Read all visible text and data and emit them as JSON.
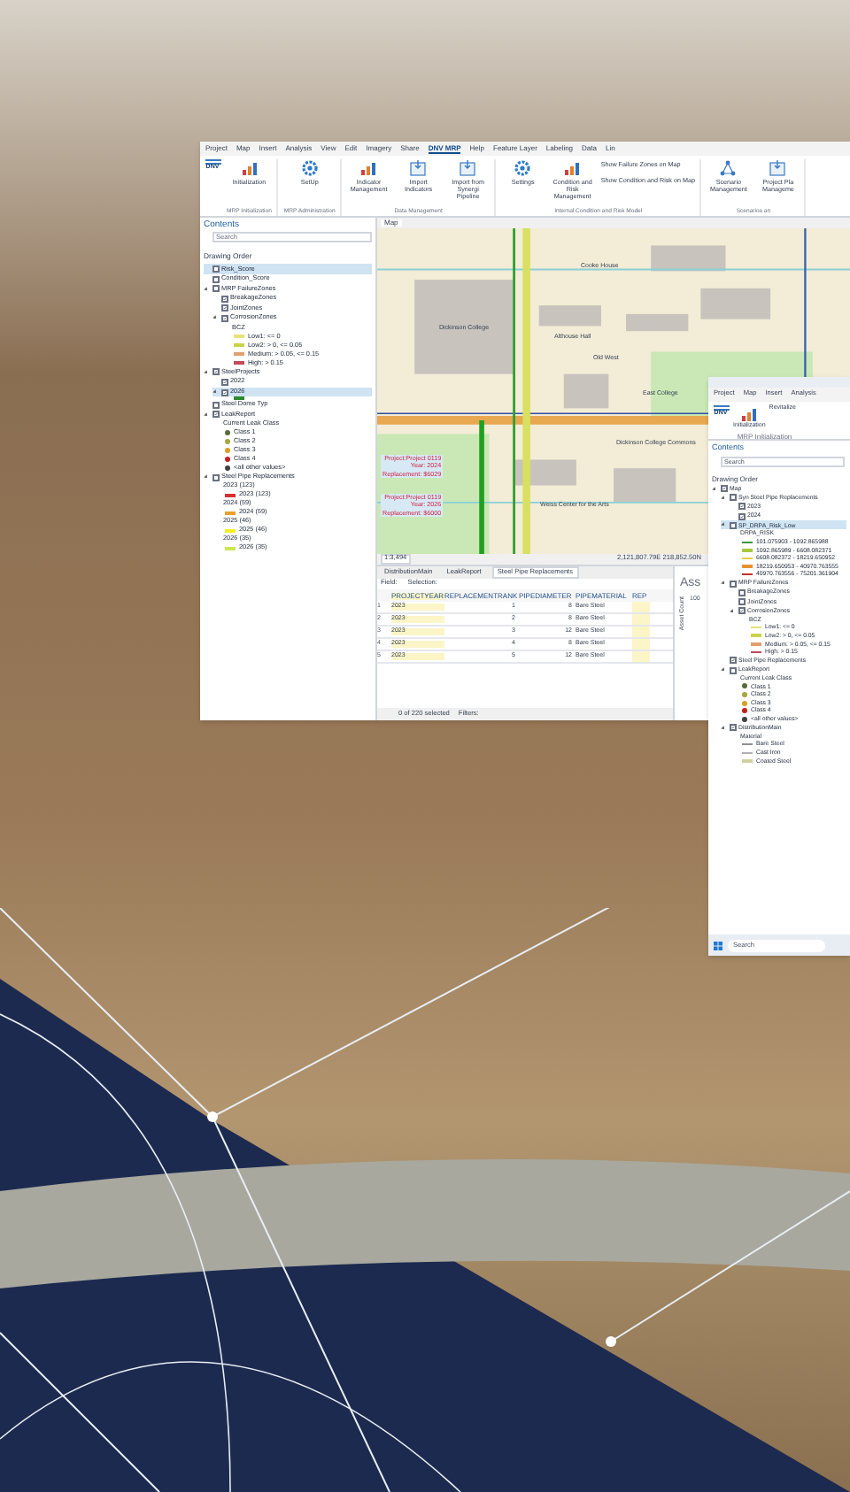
{
  "main_window": {
    "ribbon_tabs": [
      {
        "label": "Project",
        "selected": false
      },
      {
        "label": "Map",
        "selected": false
      },
      {
        "label": "Insert",
        "selected": false
      },
      {
        "label": "Analysis",
        "selected": false
      },
      {
        "label": "View",
        "selected": false
      },
      {
        "label": "Edit",
        "selected": false
      },
      {
        "label": "Imagery",
        "selected": false
      },
      {
        "label": "Share",
        "selected": false
      },
      {
        "label": "DNV MRP",
        "selected": true
      },
      {
        "label": "Help",
        "selected": false
      },
      {
        "label": "Feature Layer",
        "selected": false
      },
      {
        "label": "Labeling",
        "selected": false
      },
      {
        "label": "Data",
        "selected": false
      },
      {
        "label": "Lin",
        "selected": false
      }
    ],
    "logo": "DNV",
    "ribbon_groups": [
      {
        "label": "MRP Initialization",
        "buttons": [
          {
            "label": "Initialization",
            "kind": "chart"
          }
        ]
      },
      {
        "label": "MRP Administration",
        "buttons": [
          {
            "label": "SetUp",
            "kind": "gear"
          }
        ]
      },
      {
        "label": "Data Management",
        "buttons": [
          {
            "label": "Indicator Management",
            "kind": "chart"
          },
          {
            "label": "Import Indicators",
            "kind": "import"
          },
          {
            "label": "Import from Synergi Pipeline",
            "kind": "import"
          }
        ]
      },
      {
        "label": "Internal Condition and Risk Model",
        "buttons": [
          {
            "label": "Settings",
            "kind": "gear"
          },
          {
            "label": "Condition and Risk Management",
            "kind": "chart"
          }
        ],
        "links": [
          "Show Failure Zones on Map",
          "Show Condition and Risk on Map"
        ]
      },
      {
        "label": "Scenarios an",
        "buttons": [
          {
            "label": "Scenario Management",
            "kind": "network"
          },
          {
            "label": "Project Pla Manageme",
            "kind": "import"
          }
        ]
      }
    ],
    "contents": {
      "title": "Contents",
      "search": {
        "placeholder": "Search"
      },
      "heading": "Drawing Order",
      "tree": [
        {
          "label": "Risk_Score",
          "checked": false,
          "selected": true
        },
        {
          "label": "Condition_Score",
          "checked": false,
          "selected": false
        },
        {
          "label": "MRP FailureZones",
          "checked": false,
          "selected": false,
          "expanded": true,
          "children": [
            {
              "label": "BreakageZones",
              "checked": true,
              "selected": false
            },
            {
              "label": "JointZones",
              "checked": true,
              "selected": false
            },
            {
              "label": "CorrosionZones",
              "checked": true,
              "selected": false,
              "expanded": true,
              "legend": [
                {
                  "kind": "heading",
                  "label": "BCZ"
                },
                {
                  "kind": "line",
                  "label": "Low1: <= 0",
                  "color": "#e6e27a"
                },
                {
                  "kind": "line",
                  "label": "Low2: > 0, <= 0.05",
                  "color": "#c9d34a"
                },
                {
                  "kind": "line",
                  "label": "Medium: > 0.05, <= 0.15",
                  "color": "#e0a070"
                },
                {
                  "kind": "line",
                  "label": "High: > 0.15",
                  "color": "#c04a5a"
                }
              ]
            }
          ]
        },
        {
          "label": "SteelProjects",
          "checked": true,
          "selected": false,
          "expanded": true,
          "children": [
            {
              "label": "2022",
              "checked": true,
              "selected": false
            },
            {
              "label": "2026",
              "checked": true,
              "selected": true,
              "expanded": true,
              "legend": [
                {
                  "kind": "line",
                  "color": "#2f8a2f"
                }
              ]
            }
          ]
        },
        {
          "label": "Steel Dome Typ",
          "checked": false,
          "selected": false
        },
        {
          "label": "LeakReport",
          "checked": true,
          "selected": false,
          "expanded": true,
          "legend": [
            {
              "kind": "heading",
              "label": "Current Leak Class"
            },
            {
              "kind": "dot",
              "label": "Class 1",
              "color": "#5a6a3a"
            },
            {
              "kind": "dot",
              "label": "Class 2",
              "color": "#a8a440"
            },
            {
              "kind": "dot",
              "label": "Class 3",
              "color": "#d8a020"
            },
            {
              "kind": "dot",
              "label": "Class 4",
              "color": "#c02020"
            },
            {
              "kind": "dot",
              "label": "<all other values>",
              "color": "#404040"
            }
          ]
        },
        {
          "label": "Steel Pipe Replacements",
          "checked": false,
          "selected": false,
          "expanded": true,
          "legend": [
            {
              "kind": "heading",
              "label": "2023 (123)"
            },
            {
              "kind": "line",
              "label": "2023 (123)",
              "color": "#d83030"
            },
            {
              "kind": "heading",
              "label": "2024 (59)"
            },
            {
              "kind": "line",
              "label": "2024 (59)",
              "color": "#e8a030"
            },
            {
              "kind": "heading",
              "label": "2025 (46)"
            },
            {
              "kind": "line",
              "label": "2025 (46)",
              "color": "#f0f020"
            },
            {
              "kind": "heading",
              "label": "2026 (35)"
            },
            {
              "kind": "line",
              "label": "2026 (35)",
              "color": "#c8e850"
            }
          ]
        }
      ]
    },
    "map": {
      "tab": "Map",
      "labels": [
        "Cooke House",
        "Dickinson College",
        "Althouse Hall",
        "Old West",
        "East College",
        "Dickinson College Commons",
        "Weiss Center for the Arts"
      ],
      "popups": [
        [
          "Project:Project 0119",
          "Year: 2024",
          "Replacement: $6029"
        ],
        [
          "Project:Project 0119",
          "Year: 2026",
          "Replacement: $6000"
        ]
      ],
      "scale": "1:3,494",
      "coordinates": "2,121,807.79E 218,852.50N"
    },
    "table": {
      "tabs": [
        {
          "label": "DistributionMain",
          "selected": false
        },
        {
          "label": "LeakReport",
          "selected": false
        },
        {
          "label": "Steel Pipe Replacements",
          "selected": true
        }
      ],
      "field_label": "Field:",
      "selection_label": "Selection:",
      "columns": [
        "",
        "PROJECTYEAR",
        "REPLACEMENTRANK",
        "PIPEDIAMETER",
        "PIPEMATERIAL",
        "REP"
      ],
      "rows": [
        [
          "1",
          "2023",
          "1",
          "8",
          "Bare Steel"
        ],
        [
          "2",
          "2023",
          "2",
          "8",
          "Bare Steel"
        ],
        [
          "3",
          "2023",
          "3",
          "12",
          "Bare Steel"
        ],
        [
          "4",
          "2023",
          "4",
          "8",
          "Bare Steel"
        ],
        [
          "5",
          "2023",
          "5",
          "12",
          "Bare Steel"
        ]
      ],
      "status": "0 of 220 selected",
      "filters": "Filters:"
    },
    "chart_panel": {
      "title": "Ass",
      "tick": "100",
      "axis_label": "Asset Count"
    }
  },
  "second_window": {
    "ribbon_tabs": [
      {
        "label": "Project",
        "selected": false
      },
      {
        "label": "Map",
        "selected": false
      },
      {
        "label": "Insert",
        "selected": false
      },
      {
        "label": "Analysis",
        "selected": false
      }
    ],
    "logo": "DNV",
    "buttons": [
      "Initialization",
      "Revitalize"
    ],
    "group": "MRP Initialization",
    "contents": {
      "title": "Contents",
      "search": {
        "value": "Search"
      },
      "heading": "Drawing Order",
      "tree": [
        {
          "label": "Map",
          "checked": true,
          "selected": false,
          "expanded": true,
          "children": [
            {
              "label": "Syn Steel Pipe Replacements",
              "checked": false,
              "selected": false,
              "expanded": true,
              "children": [
                {
                  "label": "2023",
                  "checked": true,
                  "selected": false
                },
                {
                  "label": "2024",
                  "checked": true,
                  "selected": false
                }
              ]
            },
            {
              "label": "SP_DRPA_Risk_Low",
              "checked": false,
              "selected": true,
              "expanded": true,
              "legend": [
                {
                  "kind": "heading",
                  "label": "DRPA_RISK"
                },
                {
                  "kind": "line",
                  "label": "101.075903 - 1092.865988",
                  "color": "#3a9a3a"
                },
                {
                  "kind": "line",
                  "label": "1092.865989 - 6608.082371",
                  "color": "#a8c840"
                },
                {
                  "kind": "line",
                  "label": "6608.082372 - 18219.650952",
                  "color": "#e8d040"
                },
                {
                  "kind": "line",
                  "label": "18219.650953 - 40970.763555",
                  "color": "#e89030"
                },
                {
                  "kind": "line",
                  "label": "40970.763556 - 75201.361904",
                  "color": "#c83030"
                }
              ]
            },
            {
              "label": "MRP FailureZones",
              "checked": false,
              "selected": false,
              "expanded": true,
              "children": [
                {
                  "label": "BreakageZones",
                  "checked": false,
                  "selected": false
                },
                {
                  "label": "JointZones",
                  "checked": false,
                  "selected": false
                },
                {
                  "label": "CorrosionZones",
                  "checked": true,
                  "selected": false,
                  "expanded": true,
                  "legend": [
                    {
                      "kind": "heading",
                      "label": "BCZ"
                    },
                    {
                      "kind": "line",
                      "label": "Low1: <= 0",
                      "color": "#e6e27a"
                    },
                    {
                      "kind": "line",
                      "label": "Low2: > 0, <= 0.05",
                      "color": "#c9d34a"
                    },
                    {
                      "kind": "line",
                      "label": "Medium: > 0.05, <= 0.15",
                      "color": "#e0a070"
                    },
                    {
                      "kind": "line",
                      "label": "High: > 0.15",
                      "color": "#c04a5a"
                    }
                  ]
                }
              ]
            },
            {
              "label": "Steel Pipe Replacements",
              "checked": true,
              "selected": false
            },
            {
              "label": "LeakReport",
              "checked": false,
              "selected": false,
              "expanded": true,
              "legend": [
                {
                  "kind": "heading",
                  "label": "Current Leak Class"
                },
                {
                  "kind": "dot",
                  "label": "Class 1",
                  "color": "#5a6a3a"
                },
                {
                  "kind": "dot",
                  "label": "Class 2",
                  "color": "#a8a440"
                },
                {
                  "kind": "dot",
                  "label": "Class 3",
                  "color": "#d8a020"
                },
                {
                  "kind": "dot",
                  "label": "Class 4",
                  "color": "#c02020"
                },
                {
                  "kind": "dot",
                  "label": "<all other values>",
                  "color": "#404040"
                }
              ]
            },
            {
              "label": "DistributionMain",
              "checked": true,
              "selected": false,
              "expanded": true,
              "legend": [
                {
                  "kind": "heading",
                  "label": "Material"
                },
                {
                  "kind": "line",
                  "label": "Bare Steel",
                  "color": "#909090"
                },
                {
                  "kind": "line",
                  "label": "Cast Iron",
                  "color": "#b0b0b0"
                },
                {
                  "kind": "line",
                  "label": "Coated Steel",
                  "color": "#d0d0a0"
                }
              ]
            }
          ]
        }
      ]
    },
    "taskbar_search": {
      "placeholder": "Search"
    }
  }
}
